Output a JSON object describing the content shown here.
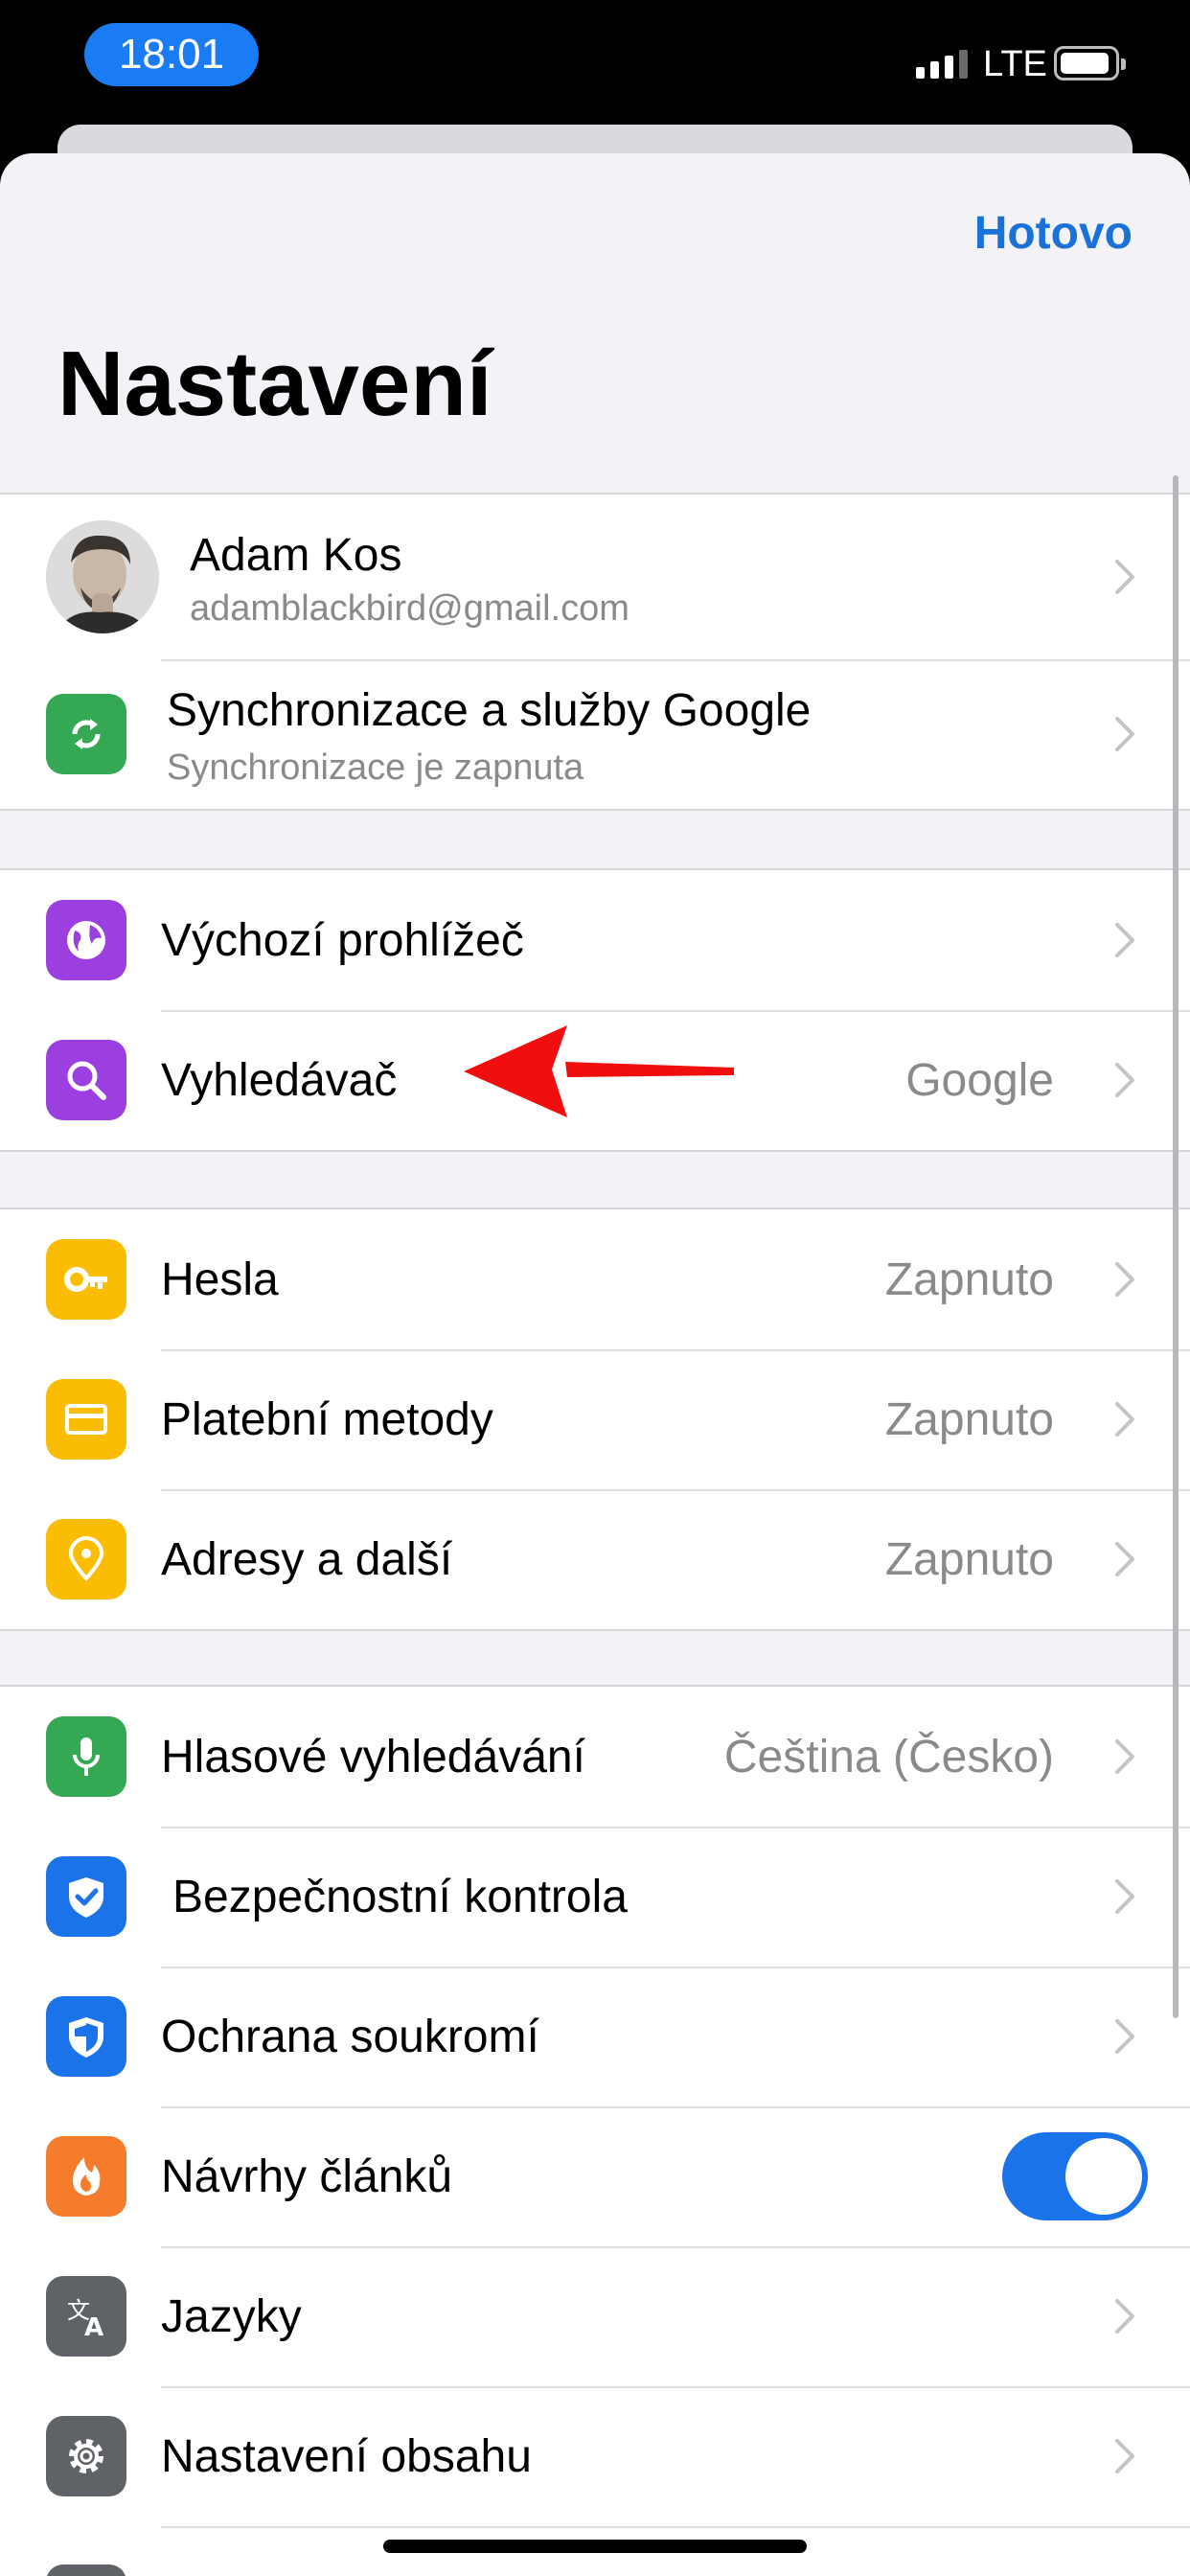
{
  "status": {
    "time": "18:01",
    "network": "LTE"
  },
  "header": {
    "done_label": "Hotovo",
    "title": "Nastavení"
  },
  "profile": {
    "name": "Adam Kos",
    "email": "adamblackbird@gmail.com"
  },
  "sync": {
    "title": "Synchronizace a služby Google",
    "subtitle": "Synchronizace je zapnuta"
  },
  "browser_group": [
    {
      "label": "Výchozí prohlížeč",
      "icon": "globe-icon",
      "color": "#9b3fe0"
    },
    {
      "label": "Vyhledávač",
      "value": "Google",
      "icon": "search-icon",
      "color": "#9b3fe0"
    }
  ],
  "autofill_group": [
    {
      "label": "Hesla",
      "value": "Zapnuto",
      "icon": "key-icon",
      "color": "#fbbc04"
    },
    {
      "label": "Platební metody",
      "value": "Zapnuto",
      "icon": "card-icon",
      "color": "#fbbc04"
    },
    {
      "label": "Adresy a další",
      "value": "Zapnuto",
      "icon": "location-pin-icon",
      "color": "#fbbc04"
    }
  ],
  "misc_group": [
    {
      "label": "Hlasové vyhledávání",
      "value": "Čeština (Česko)",
      "icon": "microphone-icon",
      "color": "#34a853"
    },
    {
      "label": "Bezpečnostní kontrola",
      "icon": "shield-check-icon",
      "color": "#1a73e8"
    },
    {
      "label": "Ochrana soukromí",
      "icon": "shield-half-icon",
      "color": "#1a73e8"
    },
    {
      "label": "Návrhy článků",
      "toggle": "on",
      "icon": "flame-icon",
      "color": "#f47c2c"
    },
    {
      "label": "Jazyky",
      "icon": "translate-icon",
      "color": "#5f6368"
    },
    {
      "label": "Nastavení obsahu",
      "icon": "gear-icon",
      "color": "#5f6368"
    }
  ]
}
